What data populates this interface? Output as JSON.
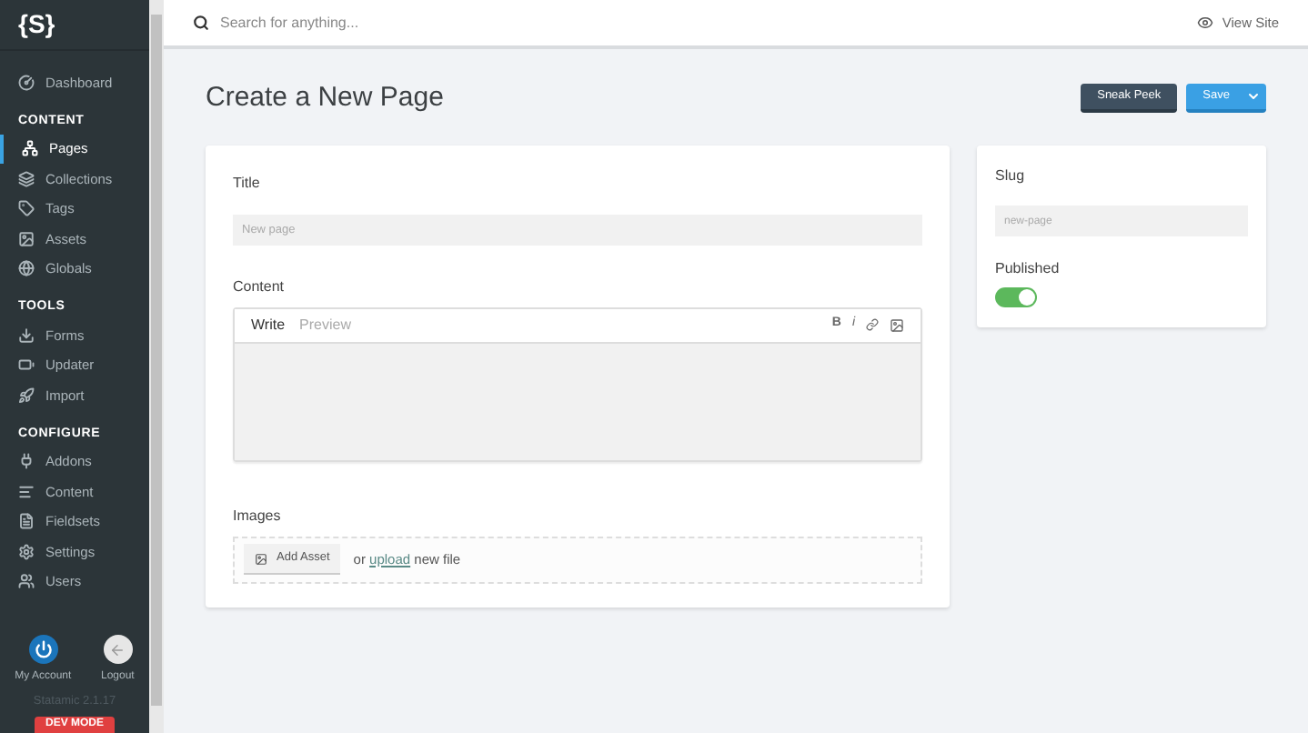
{
  "sidebar": {
    "logo": "{S}",
    "sections": [
      {
        "items": [
          {
            "label": "Dashboard",
            "selected": false
          }
        ]
      },
      {
        "heading": "CONTENT",
        "items": [
          {
            "label": "Pages",
            "selected": true
          },
          {
            "label": "Collections",
            "selected": false
          },
          {
            "label": "Tags",
            "selected": false
          },
          {
            "label": "Assets",
            "selected": false
          },
          {
            "label": "Globals",
            "selected": false
          }
        ]
      },
      {
        "heading": "TOOLS",
        "items": [
          {
            "label": "Forms",
            "selected": false
          },
          {
            "label": "Updater",
            "selected": false
          },
          {
            "label": "Import",
            "selected": false
          }
        ]
      },
      {
        "heading": "CONFIGURE",
        "items": [
          {
            "label": "Addons",
            "selected": false
          },
          {
            "label": "Content",
            "selected": false
          },
          {
            "label": "Fieldsets",
            "selected": false
          },
          {
            "label": "Settings",
            "selected": false
          },
          {
            "label": "Users",
            "selected": false
          }
        ]
      }
    ],
    "account": "My Account",
    "logout": "Logout",
    "version": "Statamic 2.1.17",
    "badge": "DEV MODE"
  },
  "topbar": {
    "search": {
      "placeholder": "Search for anything..."
    },
    "view_site": "View Site"
  },
  "page": {
    "title": "Create a New Page",
    "buttons": {
      "sneak_peek": "Sneak Peek",
      "save": "Save"
    }
  },
  "form": {
    "title": {
      "label": "Title",
      "placeholder": "New page"
    },
    "content": {
      "label": "Content",
      "tabs": [
        {
          "label": "Write",
          "selected": true
        },
        {
          "label": "Preview",
          "selected": false
        }
      ],
      "toolbar": [
        "B",
        "i"
      ]
    },
    "images": {
      "label": "Images",
      "add_asset": "Add Asset",
      "text_before": "or",
      "link": "upload",
      "text_after": "new file"
    }
  },
  "meta": {
    "slug": {
      "label": "Slug",
      "placeholder": "new-page"
    },
    "published": {
      "label": "Published",
      "on": true
    }
  }
}
